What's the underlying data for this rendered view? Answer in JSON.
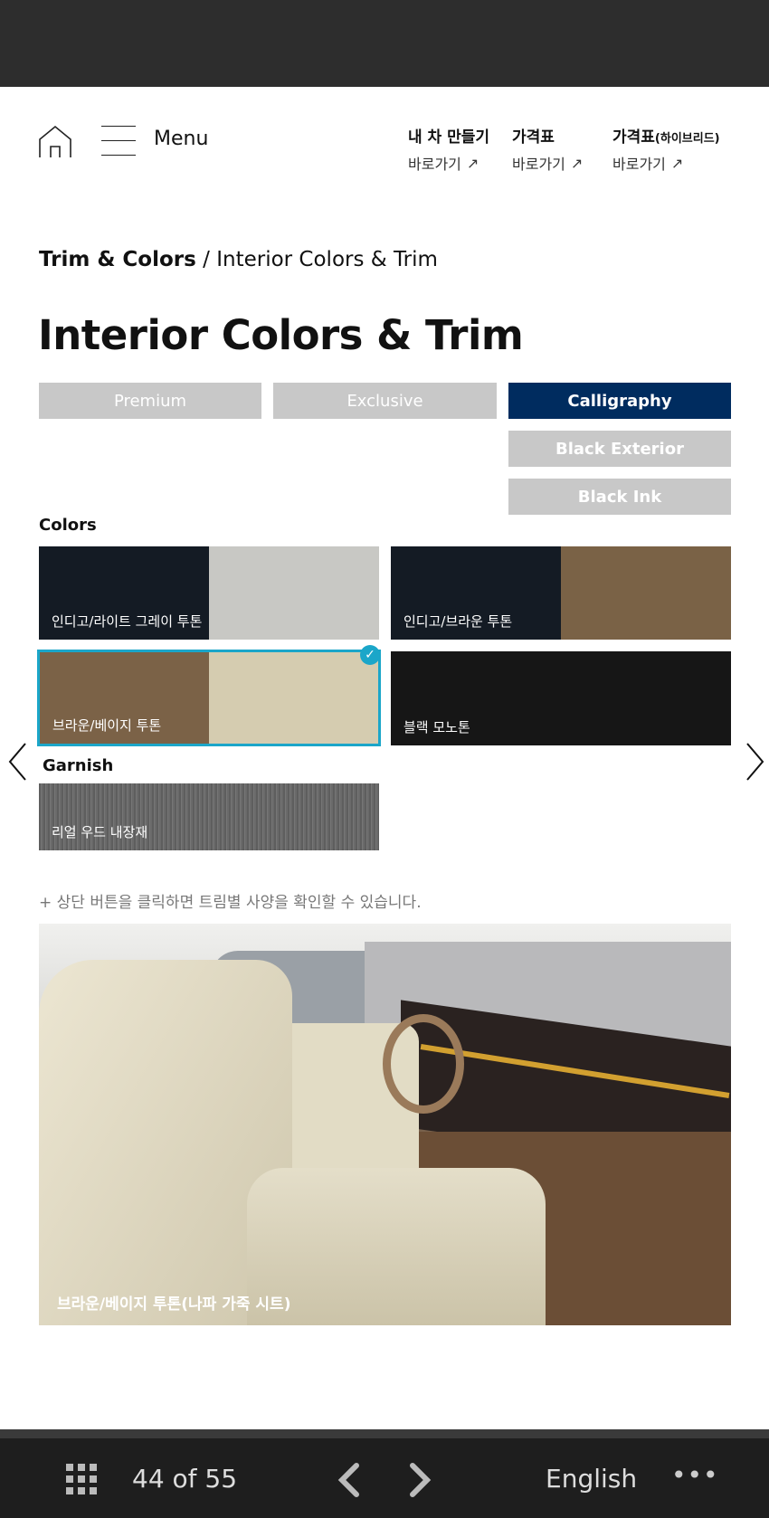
{
  "header": {
    "menu_label": "Menu",
    "links": [
      {
        "title": "내 차 만들기",
        "sub": "바로가기"
      },
      {
        "title": "가격표",
        "sub": "바로가기"
      },
      {
        "title": "가격표",
        "title_suffix": "(하이브리드)",
        "sub": "바로가기"
      }
    ]
  },
  "breadcrumb": {
    "parent": "Trim & Colors",
    "separator": " / ",
    "current": "Interior Colors & Trim"
  },
  "page_title": "Interior Colors & Trim",
  "trims": [
    {
      "label": "Premium",
      "active": false
    },
    {
      "label": "Exclusive",
      "active": false
    },
    {
      "label": "Calligraphy",
      "active": true
    },
    {
      "label": "Black Exterior",
      "active": false
    },
    {
      "label": "Black Ink",
      "active": false
    }
  ],
  "colors_heading": "Colors",
  "colors": [
    {
      "label": "인디고/라이트 그레이 투톤",
      "left": "#141b24",
      "right": "#c8c8c4",
      "selected": false
    },
    {
      "label": "인디고/브라운 투톤",
      "left": "#141b24",
      "right": "#7a6246",
      "selected": false
    },
    {
      "label": "브라운/베이지 투톤",
      "left": "#7b6247",
      "right": "#d5ccb0",
      "selected": true
    },
    {
      "label": "블랙 모노톤",
      "left": "#161616",
      "right": "#161616",
      "selected": false
    }
  ],
  "garnish_heading": "Garnish",
  "garnish": [
    {
      "label": "리얼 우드 내장재",
      "color": "#6a6a6a"
    }
  ],
  "note": "+ 상단 버튼을 클릭하면 트림별 사양을 확인할 수 있습니다.",
  "image_caption": "브라운/베이지 투톤(나파 가죽 시트)",
  "colors_accent": {
    "selected_border": "#1ba6c9",
    "active_tab": "#002c5f"
  },
  "viewer": {
    "page_indicator": "44 of 55",
    "language": "English"
  }
}
